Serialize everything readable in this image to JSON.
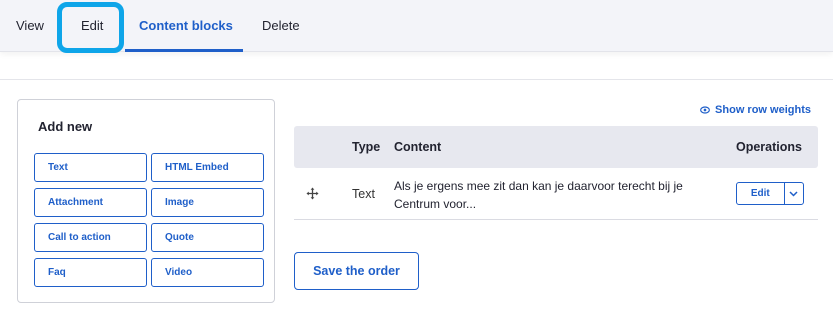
{
  "tabs": {
    "view": "View",
    "edit": "Edit",
    "content_blocks": "Content blocks",
    "delete": "Delete"
  },
  "add_new": {
    "title": "Add new",
    "blocks": [
      "Text",
      "HTML Embed",
      "Attachment",
      "Image",
      "Call to action",
      "Quote",
      "Faq",
      "Video"
    ]
  },
  "show_row_weights": "Show row weights",
  "table": {
    "headers": [
      "Type",
      "Content",
      "Operations"
    ],
    "rows": [
      {
        "type": "Text",
        "content": "Als je ergens mee zit dan kan je daarvoor terecht bij je Centrum voor...",
        "operation": "Edit"
      }
    ]
  },
  "save_order": "Save the order",
  "colors": {
    "accent": "#1f5fc9",
    "focus_ring": "#0ea5e9",
    "header_bg": "#e7e8ef"
  },
  "icons": {
    "show_weights": "eye-icon",
    "drag": "move-arrows-icon",
    "dropdown": "chevron-down-icon"
  }
}
